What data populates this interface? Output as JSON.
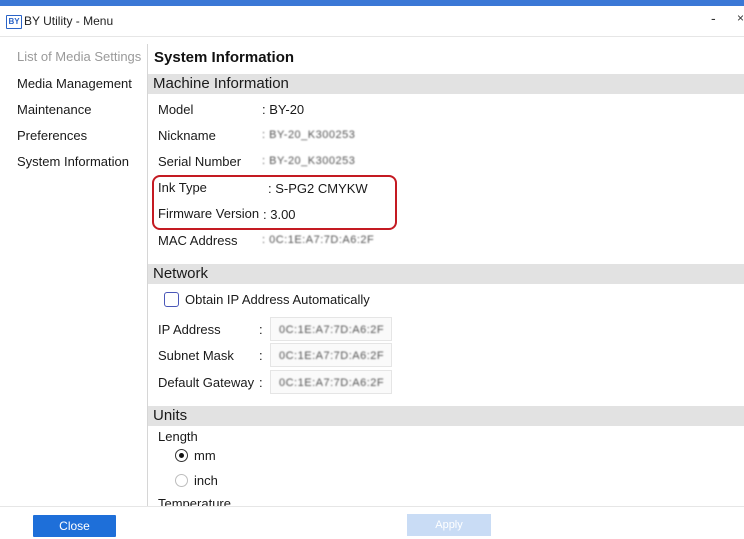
{
  "window": {
    "logo_text": "BY",
    "title": "BY Utility - Menu",
    "minimize_label": "-",
    "close_label": "×",
    "accent_color": "#3b78d6"
  },
  "sidebar": {
    "items": [
      {
        "label": "List of Media Settings",
        "disabled": true
      },
      {
        "label": "Media Management",
        "disabled": false
      },
      {
        "label": "Maintenance",
        "disabled": false
      },
      {
        "label": "Preferences",
        "disabled": false
      },
      {
        "label": "System Information",
        "disabled": false
      }
    ]
  },
  "main": {
    "title": "System Information",
    "machine": {
      "header": "Machine Information",
      "model_label": "Model",
      "model_value": ": BY-20",
      "nickname_label": "Nickname",
      "nickname_value": ": BY-20_K300253",
      "serial_label": "Serial Number",
      "serial_value": ": BY-20_K300253",
      "ink_label": "Ink Type",
      "ink_value": ": S-PG2 CMYKW",
      "firmware_label": "Firmware Version",
      "firmware_value": ": 3.00",
      "mac_label": "MAC Address",
      "mac_value": ": 0C:1E:A7:7D:A6:2F"
    },
    "network": {
      "header": "Network",
      "auto_ip_label": "Obtain IP Address Automatically",
      "auto_ip_checked": false,
      "ip_label": "IP Address",
      "ip_colon": ":",
      "ip_value": "0C:1E:A7:7D:A6:2F",
      "subnet_label": "Subnet Mask",
      "subnet_colon": ":",
      "subnet_value": "0C:1E:A7:7D:A6:2F",
      "gateway_label": "Default Gateway",
      "gateway_colon": ":",
      "gateway_value": "0C:1E:A7:7D:A6:2F"
    },
    "units": {
      "header": "Units",
      "length_label": "Length",
      "mm_label": "mm",
      "inch_label": "inch",
      "selected_length": "mm",
      "temperature_label": "Temperature"
    },
    "highlight_color": "#c41a22"
  },
  "footer": {
    "close_label": "Close",
    "apply_label": "Apply"
  }
}
